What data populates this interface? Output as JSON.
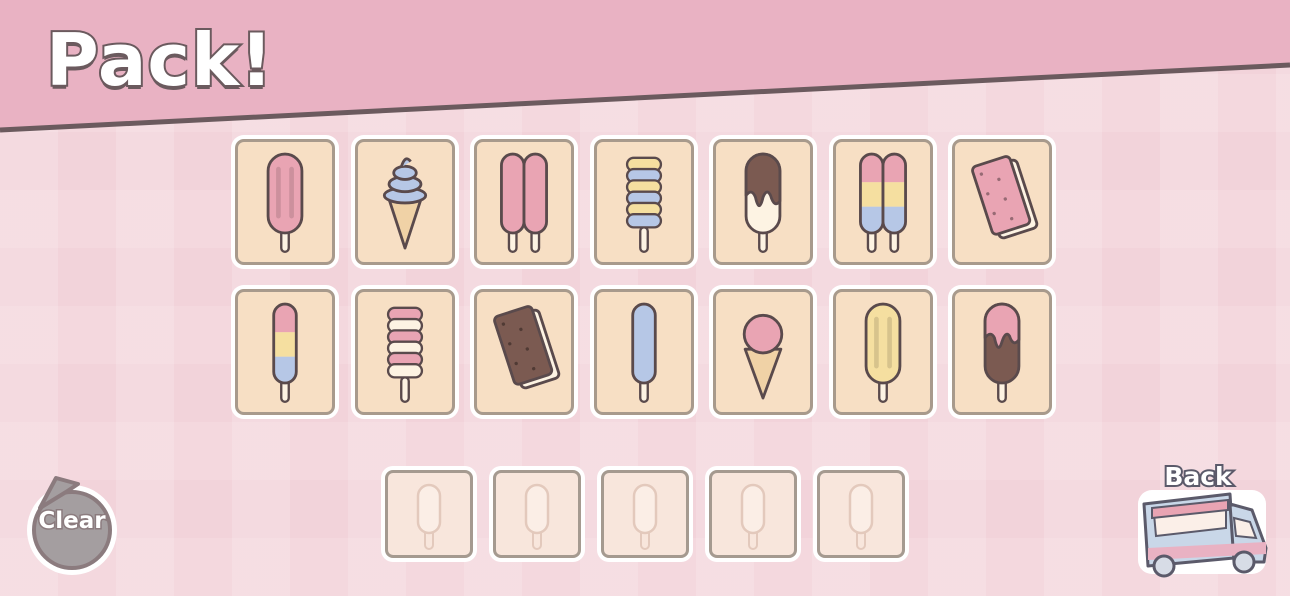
{
  "title": "Pack!",
  "clear_button": {
    "label": "Clear",
    "icon": "circular-arrow-icon"
  },
  "back_button": {
    "label": "Back",
    "icon": "ice-cream-truck-icon"
  },
  "colors": {
    "banner": "#e9b2c3",
    "card_bg": "#f7dfc4",
    "outline": "#5a4a4c",
    "pink": "#e9a4b3",
    "blue": "#b6c7e6",
    "yellow": "#f5dfa0",
    "chocolate": "#7b5a51",
    "cream": "#fdf3e3",
    "cone": "#f0d2a6"
  },
  "menu_items": [
    {
      "name": "pink-popsicle",
      "kind": "popsicle",
      "flavor": "pink"
    },
    {
      "name": "blue-soft-serve-cone",
      "kind": "softserve",
      "flavor": "blue"
    },
    {
      "name": "pink-twin-popsicle",
      "kind": "twin",
      "flavor": "pink"
    },
    {
      "name": "yellow-blue-twister-pop",
      "kind": "twister",
      "flavor": "yellow-blue"
    },
    {
      "name": "chocolate-dipped-popsicle",
      "kind": "dipped",
      "flavor": "chocolate"
    },
    {
      "name": "rainbow-twin-popsicle",
      "kind": "twin-rainbow",
      "flavor": "rainbow"
    },
    {
      "name": "strawberry-ice-cream-sandwich",
      "kind": "sandwich",
      "flavor": "strawberry"
    },
    {
      "name": "rainbow-rocket-pop",
      "kind": "rocket",
      "flavor": "rainbow"
    },
    {
      "name": "pink-cream-twister-pop",
      "kind": "twister",
      "flavor": "pink-cream"
    },
    {
      "name": "chocolate-ice-cream-sandwich",
      "kind": "sandwich",
      "flavor": "chocolate"
    },
    {
      "name": "blue-stick-pop",
      "kind": "slim",
      "flavor": "blue"
    },
    {
      "name": "strawberry-scoop-cone",
      "kind": "scoop",
      "flavor": "pink"
    },
    {
      "name": "yellow-popsicle",
      "kind": "popsicle",
      "flavor": "yellow"
    },
    {
      "name": "strawberry-dipped-chocolate-popsicle",
      "kind": "dipped-choc",
      "flavor": "strawberry"
    }
  ],
  "pack_slots": [
    {
      "state": "empty"
    },
    {
      "state": "empty"
    },
    {
      "state": "empty"
    },
    {
      "state": "empty"
    },
    {
      "state": "empty"
    }
  ]
}
